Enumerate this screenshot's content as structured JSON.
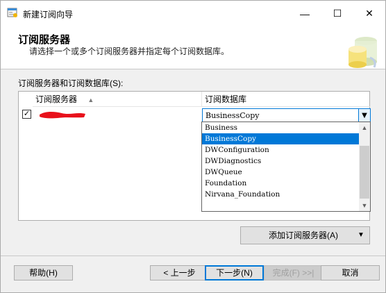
{
  "window": {
    "title": "新建订阅向导",
    "minimize_glyph": "—",
    "maximize_glyph": "☐",
    "close_glyph": "✕"
  },
  "header": {
    "title": "订阅服务器",
    "subtitle": "请选择一个或多个订阅服务器并指定每个订阅数据库。"
  },
  "section_label": "订阅服务器和订阅数据库(S):",
  "grid": {
    "columns": [
      "订阅服务器",
      "订阅数据库"
    ],
    "sort_icon": "sort-up-icon",
    "rows": [
      {
        "checked": true,
        "server": "",
        "database": "BusinessCopy"
      }
    ]
  },
  "dropdown": {
    "options": [
      "Business",
      "BusinessCopy",
      "DWConfiguration",
      "DWDiagnostics",
      "DWQueue",
      "Foundation",
      "Nirvana_Foundation"
    ],
    "selected": "BusinessCopy"
  },
  "add_button": "添加订阅服务器(A)",
  "buttons": {
    "help": "帮助(H)",
    "back": "< 上一步",
    "next": "下一步(N)",
    "finish": "完成(F) >>|",
    "cancel": "取消"
  },
  "colors": {
    "accent": "#0078d7",
    "redaction": "#e8111b"
  }
}
